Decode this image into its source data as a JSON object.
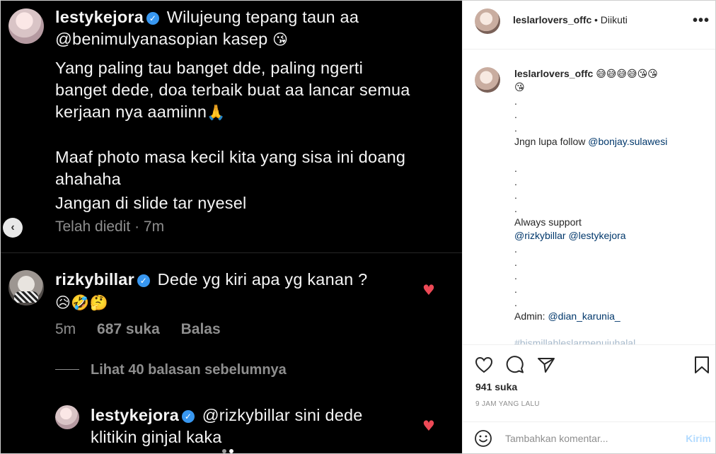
{
  "photo": {
    "first_comment": {
      "username": "lestykejora",
      "lines": [
        "Wilujeung tepang taun aa",
        "@benimulyanasopian kasep",
        "Yang paling tau banget dde, paling ngerti",
        "banget dede, doa terbaik buat aa lancar semua",
        "kerjaan nya aamiinn",
        "Maaf photo masa kecil kita yang sisa ini doang",
        "ahahaha",
        "Jangan di slide tar nyesel"
      ],
      "meta": "Telah diedit · 7m"
    },
    "second_comment": {
      "username": "rizkybillar",
      "text": "Dede yg kiri apa yg kanan ?",
      "emojis": "😥🤣🤔",
      "time": "5m",
      "likes": "687 suka",
      "reply": "Balas",
      "view_replies": "Lihat 40 balasan sebelumnya"
    },
    "reply_comment": {
      "username": "lestykejora",
      "line1": "@rizkybillar sini dede",
      "line2": "klitikin ginjal kaka"
    },
    "emoji_kiss": "😘",
    "emoji_pray": "🙏",
    "heart": "♥",
    "verified_mark": "✓",
    "back_arrow": "‹"
  },
  "side": {
    "header": {
      "username": "leslarlovers_offc",
      "follow_status": "• Diikuti",
      "more": "•••"
    },
    "caption": {
      "username": "leslarlovers_offc",
      "emojis_line1": "😅😅😅😅😘😘",
      "emojis_line2": "😘",
      "lines": [
        ".",
        ".",
        ".",
        "Jngn lupa follow ",
        "",
        ".",
        ".",
        ".",
        ".",
        "Always support",
        "@rizkybillar @lestykejora",
        ".",
        ".",
        ".",
        ".",
        ".",
        "Admin: ",
        "",
        "#bismillahleslarmenujuhalal"
      ],
      "mention_bonjay": "@bonjay.sulawesi",
      "mention_admin": "@dian_karunia_"
    },
    "likes": "941 suka",
    "time": "9 JAM YANG LALU",
    "comment_placeholder": "Tambahkan komentar...",
    "post_button": "Kirim"
  }
}
